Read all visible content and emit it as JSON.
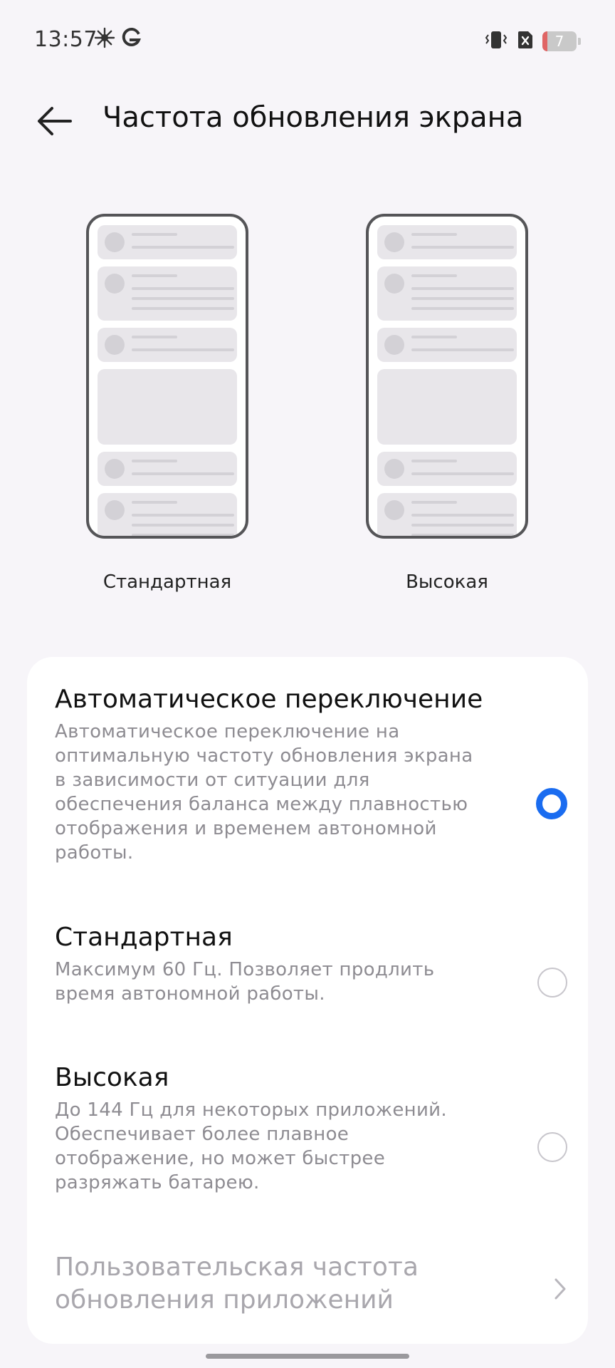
{
  "status_bar": {
    "time": "13:57",
    "battery_level": "7",
    "icons": [
      "brightness-icon",
      "google-g-icon",
      "vibrate-icon",
      "no-sim-icon",
      "battery-icon"
    ],
    "battery_color": "#e06565"
  },
  "header": {
    "title": "Частота обновления экрана",
    "back_icon": "arrow-left-icon"
  },
  "previews": [
    {
      "label": "Стандартная"
    },
    {
      "label": "Высокая"
    }
  ],
  "options": [
    {
      "title": "Автоматическое переключение",
      "description": "Автоматическое переключение на оптимальную частоту обновления экрана в зависимости от ситуации для обеспечения баланса между плавностью отображения и временем автономной работы.",
      "selected": true
    },
    {
      "title": "Стандартная",
      "description": "Максимум 60 Гц. Позволяет продлить время автономной работы.",
      "selected": false
    },
    {
      "title": "Высокая",
      "description": "До 144 Гц для некоторых приложений. Обеспечивает более плавное отображение, но может быстрее разряжать батарею.",
      "selected": false
    }
  ],
  "custom_option": {
    "label": "Пользовательская частота обновления приложений",
    "icon": "chevron-right-icon",
    "enabled": false
  },
  "colors": {
    "accent": "#1a6cf0",
    "background": "#f7f5f9",
    "card": "#ffffff",
    "secondary_text": "#8e8c92",
    "disabled_text": "#a9a7ad"
  }
}
